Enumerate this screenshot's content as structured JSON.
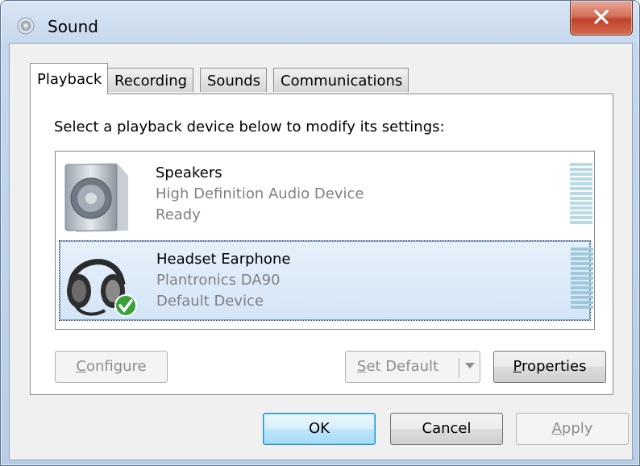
{
  "window": {
    "title": "Sound",
    "close_glyph": "x"
  },
  "tabs": [
    {
      "label": "Playback",
      "active": true
    },
    {
      "label": "Recording",
      "active": false
    },
    {
      "label": "Sounds",
      "active": false
    },
    {
      "label": "Communications",
      "active": false
    }
  ],
  "playback": {
    "instruction": "Select a playback device below to modify its settings:",
    "devices": [
      {
        "name": "Speakers",
        "description": "High Definition Audio Device",
        "status": "Ready",
        "icon": "speaker-icon",
        "selected": false,
        "default": false
      },
      {
        "name": "Headset Earphone",
        "description": "Plantronics DA90",
        "status": "Default Device",
        "icon": "headset-icon",
        "selected": true,
        "default": true
      }
    ],
    "buttons": {
      "configure": {
        "mnemonic": "C",
        "rest": "onfigure",
        "enabled": false
      },
      "set_default": {
        "mnemonic": "S",
        "rest": "et Default",
        "enabled": false
      },
      "properties": {
        "mnemonic": "P",
        "rest": "roperties",
        "enabled": true
      }
    }
  },
  "footer": {
    "ok": "OK",
    "cancel": "Cancel",
    "apply": {
      "mnemonic": "A",
      "rest": "pply",
      "enabled": false
    }
  },
  "colors": {
    "selection": "#d4e5f7",
    "meter": "#b6dbe4",
    "check": "#3aa03a",
    "close": "#c0412a"
  }
}
